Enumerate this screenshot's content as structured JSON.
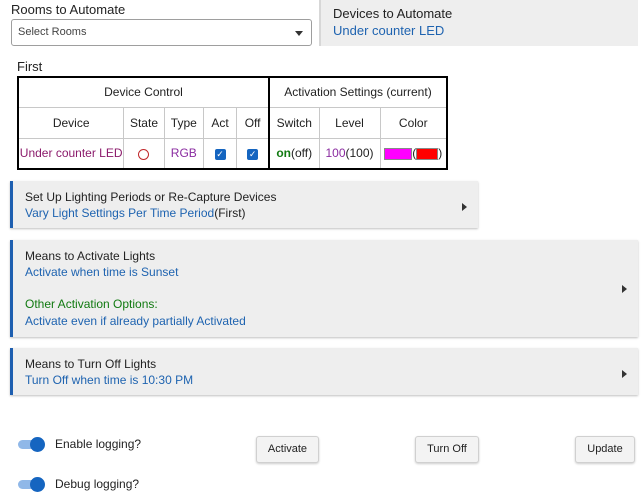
{
  "rooms": {
    "label": "Rooms to Automate",
    "placeholder": "Select Rooms"
  },
  "devices_panel": {
    "title": "Devices to Automate",
    "value": "Under counter LED"
  },
  "section_label": "First",
  "device_table": {
    "group_headers": [
      "Device Control",
      "Activation Settings (current)"
    ],
    "columns": [
      "Device",
      "State",
      "Type",
      "Act",
      "Off",
      "Switch",
      "Level",
      "Color"
    ],
    "row": {
      "device": "Under counter LED",
      "type": "RGB",
      "switch_on": "on",
      "switch_current": "(off)",
      "level": "100",
      "level_current": "(100)",
      "color_set": "#ff00ff",
      "color_current": "#ff0000"
    }
  },
  "panels": {
    "periods": {
      "title": "Set Up Lighting Periods or Re-Capture Devices",
      "value": "Vary Light Settings Per Time Period",
      "suffix": "(First)"
    },
    "activate": {
      "title": "Means to Activate Lights",
      "value": "Activate when time is Sunset",
      "other_title": "Other Activation Options:",
      "other_value": "Activate even if already partially Activated"
    },
    "turnoff": {
      "title": "Means to Turn Off Lights",
      "value": "Turn Off when time is 10:30 PM"
    }
  },
  "toggles": {
    "enable_logging": "Enable logging?",
    "debug_logging": "Debug logging?"
  },
  "buttons": {
    "activate": "Activate",
    "turn_off": "Turn Off",
    "update": "Update"
  },
  "colors": {
    "accent": "#1e5fb0",
    "link": "#1e63b0",
    "green": "#117a11"
  }
}
